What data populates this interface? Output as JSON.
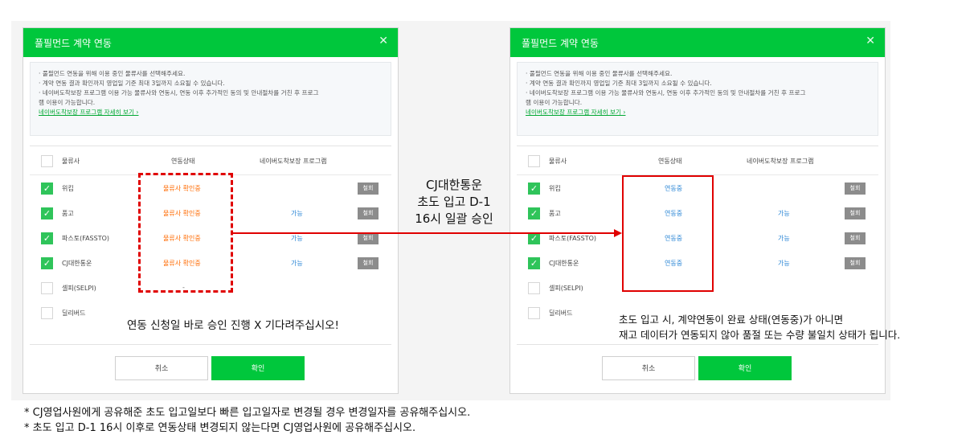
{
  "modal": {
    "title": "풀필먼드 계약 연동",
    "close_glyph": "✕",
    "notice": [
      "· 풀필먼드 연동을 위해 이용 중인 물류사를 선택해주세요.",
      "· 계약 연동 결과 확인까지 영업일 기준 최대 3일까지 소요될 수 있습니다.",
      "· 네이버도착보장 프로그램 이용 가능 물류사와 연동시, 연동 이후 추가적인 동의 및 안내절차를 거친 후 프로그",
      "  램 이용이 가능합니다."
    ],
    "notice_link": "네이버도착보장 프로그램 자세히 보기 ›",
    "headers": {
      "company": "물류사",
      "status": "연동상태",
      "program": "네이버도착보장 프로그램"
    },
    "cancel_label": "취소",
    "ok_label": "확인",
    "row_button": "철회"
  },
  "left_rows": [
    {
      "checked": true,
      "name": "위킵",
      "status": "물류사 확인중",
      "program": "",
      "button": true
    },
    {
      "checked": true,
      "name": "품고",
      "status": "물류사 확인중",
      "program": "가능",
      "button": true
    },
    {
      "checked": true,
      "name": "파스토(FASSTO)",
      "status": "물류사 확인중",
      "program": "가능",
      "button": true
    },
    {
      "checked": true,
      "name": "CJ대한통운",
      "status": "물류사 확인중",
      "program": "가능",
      "button": true
    },
    {
      "checked": false,
      "name": "셀피(SELPI)",
      "status": "-",
      "program": "",
      "button": false
    },
    {
      "checked": false,
      "name": "딜리버드",
      "status": "",
      "program": "",
      "button": false
    }
  ],
  "right_rows": [
    {
      "checked": true,
      "name": "위킵",
      "status": "연동중",
      "program": "",
      "button": true
    },
    {
      "checked": true,
      "name": "품고",
      "status": "연동중",
      "program": "가능",
      "button": true
    },
    {
      "checked": true,
      "name": "파스토(FASSTO)",
      "status": "연동중",
      "program": "가능",
      "button": true
    },
    {
      "checked": true,
      "name": "CJ대한통운",
      "status": "연동중",
      "program": "가능",
      "button": true
    },
    {
      "checked": false,
      "name": "셀피(SELPI)",
      "status": "",
      "program": "",
      "button": false
    },
    {
      "checked": false,
      "name": "딜리버드",
      "status": "",
      "program": "",
      "button": false
    }
  ],
  "annotations": {
    "callout": [
      "CJ대한통운",
      "초도 입고 D-1",
      "16시 일괄 승인"
    ],
    "left_note": "연동 신청일 바로 승인 진행 X  기다려주십시오!",
    "right_note": [
      "초도 입고 시,  계약연동이 완료 상태(연동중)가 아니면",
      "재고 데이터가 연동되지 않아 품절 또는 수량 불일치 상태가 됩니다."
    ],
    "footnotes": [
      "* CJ영업사원에게 공유해준 초도 입고일보다 빠른 입고일자로 변경될 경우 변경일자를 공유해주십시오.",
      "* 초도 입고 D-1 16시 이후로 연동상태 변경되지 않는다면 CJ영업사원에 공유해주십시오."
    ]
  },
  "colors": {
    "brand": "#00c73c",
    "highlight": "#e00000",
    "pending": "#ff6a00",
    "active": "#2a86d6"
  }
}
